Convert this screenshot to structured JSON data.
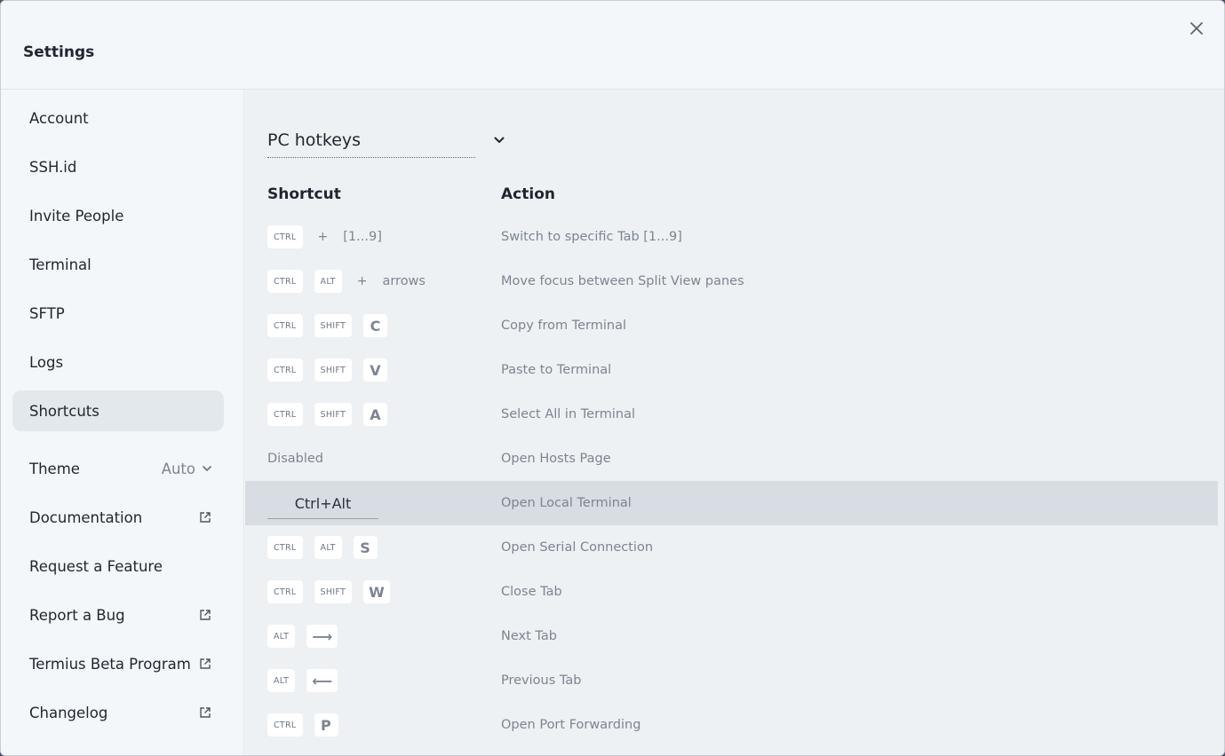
{
  "window": {
    "title": "Settings"
  },
  "sidebar": {
    "items": [
      {
        "label": "Account"
      },
      {
        "label": "SSH.id"
      },
      {
        "label": "Invite People"
      },
      {
        "label": "Terminal"
      },
      {
        "label": "SFTP"
      },
      {
        "label": "Logs"
      },
      {
        "label": "Shortcuts",
        "active": true
      },
      {
        "label": "Theme",
        "value": "Auto"
      },
      {
        "label": "Documentation",
        "icon": "external-link-icon"
      },
      {
        "label": "Request a Feature"
      },
      {
        "label": "Report a Bug",
        "icon": "external-link-icon"
      },
      {
        "label": "Termius Beta Program",
        "icon": "external-link-icon"
      },
      {
        "label": "Changelog",
        "icon": "external-link-icon"
      }
    ]
  },
  "shortcuts": {
    "preset": "PC hotkeys",
    "columns": {
      "shortcut": "Shortcut",
      "action": "Action"
    },
    "rows": [
      {
        "keys": [
          "CTRL"
        ],
        "plus": "+",
        "extra": "[1...9]",
        "action": "Switch to specific Tab [1...9]"
      },
      {
        "keys": [
          "CTRL",
          "ALT"
        ],
        "plus": "+",
        "extra": "arrows",
        "action": "Move focus between Split View panes"
      },
      {
        "keys": [
          "CTRL",
          "SHIFT"
        ],
        "big": "C",
        "action": "Copy from Terminal"
      },
      {
        "keys": [
          "CTRL",
          "SHIFT"
        ],
        "big": "V",
        "action": "Paste to Terminal"
      },
      {
        "keys": [
          "CTRL",
          "SHIFT"
        ],
        "big": "A",
        "action": "Select All in Terminal"
      },
      {
        "text": "Disabled",
        "action": "Open Hosts Page"
      },
      {
        "recording": "Ctrl+Alt",
        "action": "Open Local Terminal"
      },
      {
        "keys": [
          "CTRL",
          "ALT"
        ],
        "big": "S",
        "action": "Open Serial Connection"
      },
      {
        "keys": [
          "CTRL",
          "SHIFT"
        ],
        "big": "W",
        "action": "Close Tab"
      },
      {
        "keys": [
          "ALT"
        ],
        "big": "⟶",
        "action": "Next Tab"
      },
      {
        "keys": [
          "ALT"
        ],
        "big": "⟵",
        "action": "Previous Tab"
      },
      {
        "keys": [
          "CTRL"
        ],
        "big": "P",
        "action": "Open Port Forwarding"
      }
    ]
  },
  "colors": {
    "background": "#eef1f3",
    "sidebar": "#f4f7f9",
    "active_item": "#e3e8ec",
    "highlight_row": "#d7dde2",
    "text": "#1f2630",
    "muted_text": "#7b8591"
  }
}
